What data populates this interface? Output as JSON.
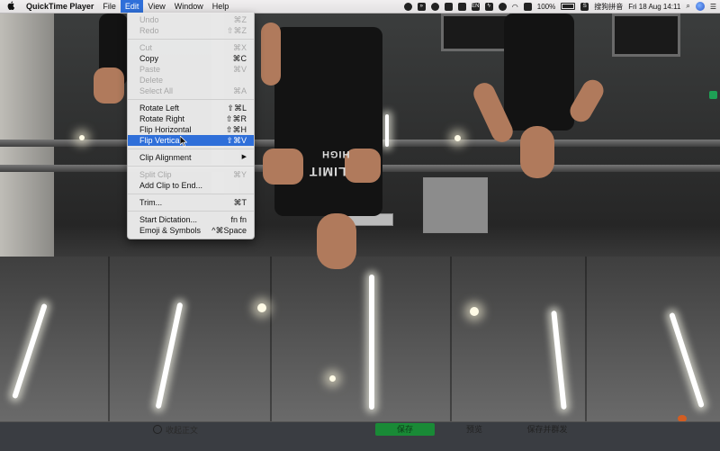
{
  "menubar": {
    "app_name": "QuickTime Player",
    "menus": [
      "File",
      "Edit",
      "View",
      "Window",
      "Help"
    ],
    "active_menu": "Edit",
    "status": {
      "battery": "100%",
      "input_method": "搜狗拼音",
      "datetime": "Fri 18 Aug  14:11",
      "en_label": "EN"
    }
  },
  "edit_menu": {
    "groups": [
      [
        {
          "label": "Undo",
          "shortcut": "⌘Z",
          "enabled": false
        },
        {
          "label": "Redo",
          "shortcut": "⇧⌘Z",
          "enabled": false
        }
      ],
      [
        {
          "label": "Cut",
          "shortcut": "⌘X",
          "enabled": false
        },
        {
          "label": "Copy",
          "shortcut": "⌘C",
          "enabled": true
        },
        {
          "label": "Paste",
          "shortcut": "⌘V",
          "enabled": false
        },
        {
          "label": "Delete",
          "shortcut": "",
          "enabled": false
        },
        {
          "label": "Select All",
          "shortcut": "⌘A",
          "enabled": false
        }
      ],
      [
        {
          "label": "Rotate Left",
          "shortcut": "⇧⌘L",
          "enabled": true
        },
        {
          "label": "Rotate Right",
          "shortcut": "⇧⌘R",
          "enabled": true
        },
        {
          "label": "Flip Horizontal",
          "shortcut": "⇧⌘H",
          "enabled": true
        },
        {
          "label": "Flip Vertical",
          "shortcut": "⇧⌘V",
          "enabled": true,
          "highlighted": true
        }
      ],
      [
        {
          "label": "Clip Alignment",
          "shortcut": "",
          "enabled": true,
          "submenu": true
        }
      ],
      [
        {
          "label": "Split Clip",
          "shortcut": "⌘Y",
          "enabled": false
        },
        {
          "label": "Add Clip to End...",
          "shortcut": "",
          "enabled": true
        }
      ],
      [
        {
          "label": "Trim...",
          "shortcut": "⌘T",
          "enabled": true
        }
      ],
      [
        {
          "label": "Start Dictation...",
          "shortcut": "fn fn",
          "enabled": true
        },
        {
          "label": "Emoji & Symbols",
          "shortcut": "^⌘Space",
          "enabled": true
        }
      ]
    ]
  },
  "video": {
    "shirt_text_1": "LIMIT",
    "shirt_text_2": "HIGH"
  },
  "bottom_bar": {
    "circle_label": "收起正文",
    "save_button": "保存",
    "preview_button": "预览",
    "save_publish_button": "保存并群发"
  },
  "colors": {
    "accent": "#2f6fd9",
    "save_green": "#198a36"
  }
}
